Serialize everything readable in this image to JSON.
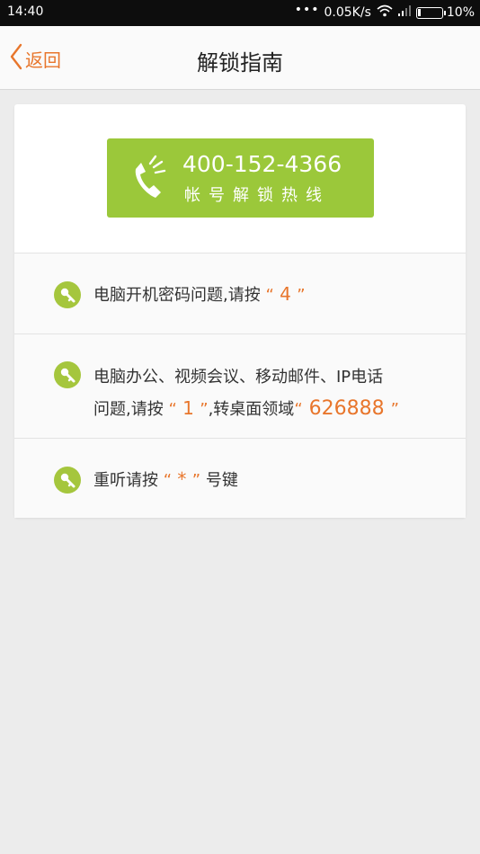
{
  "status_bar": {
    "time": "14:40",
    "dots": "•••",
    "speed": "0.05K/s",
    "battery": "10%",
    "icons": [
      "wifi-icon",
      "signal-icon",
      "battery-icon"
    ]
  },
  "nav": {
    "back_label": "返回",
    "title": "解锁指南"
  },
  "hotline": {
    "number": "400-152-4366",
    "caption": "帐号解锁热线",
    "icon": "phone-icon"
  },
  "rows": [
    {
      "icon": "key-icon",
      "text_before": "电脑开机密码问题,请按",
      "quote_open": "“",
      "key": " 4 ",
      "quote_close": "”"
    },
    {
      "icon": "key-icon",
      "line1": "电脑办公、视频会议、移动邮件、IP电话",
      "line2_before": "问题,请按",
      "quote_open": "“",
      "key": " 1 ",
      "quote_close": "”",
      "line2_mid": ",转桌面领域",
      "domain_open": "“",
      "domain": " 626888 ",
      "domain_close": "”"
    },
    {
      "icon": "key-icon",
      "text_before": "重听请按",
      "quote_open": "“",
      "key": " * ",
      "quote_close": "”",
      "text_after": "号键"
    }
  ],
  "colors": {
    "accent_orange": "#e8762c",
    "hotline_green": "#9bc83a",
    "key_icon_green": "#a5c63d"
  }
}
